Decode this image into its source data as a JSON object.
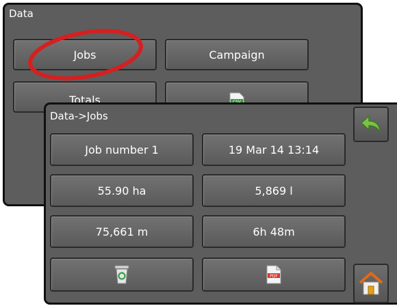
{
  "data_menu": {
    "title": "Data",
    "jobs_label": "Jobs",
    "campaign_label": "Campaign",
    "totals_label": "Totals",
    "csv_icon_text": "CSV"
  },
  "jobs_screen": {
    "title": "Data->Jobs",
    "job_name": "Job number 1",
    "job_date": "19 Mar 14 13:14",
    "area": "55.90 ha",
    "volume": "5,869 l",
    "distance": "75,661 m",
    "duration": "6h 48m",
    "pdf_icon_text": "PDF"
  },
  "icons": {
    "delete": "recycle-bin-icon",
    "export": "pdf-file-icon",
    "back": "back-arrow-icon",
    "home": "home-icon",
    "csv": "csv-file-icon"
  },
  "colors": {
    "panel_bg": "#5d5d5d",
    "highlight_circle": "#d42020",
    "back_arrow": "#7cc04a"
  }
}
